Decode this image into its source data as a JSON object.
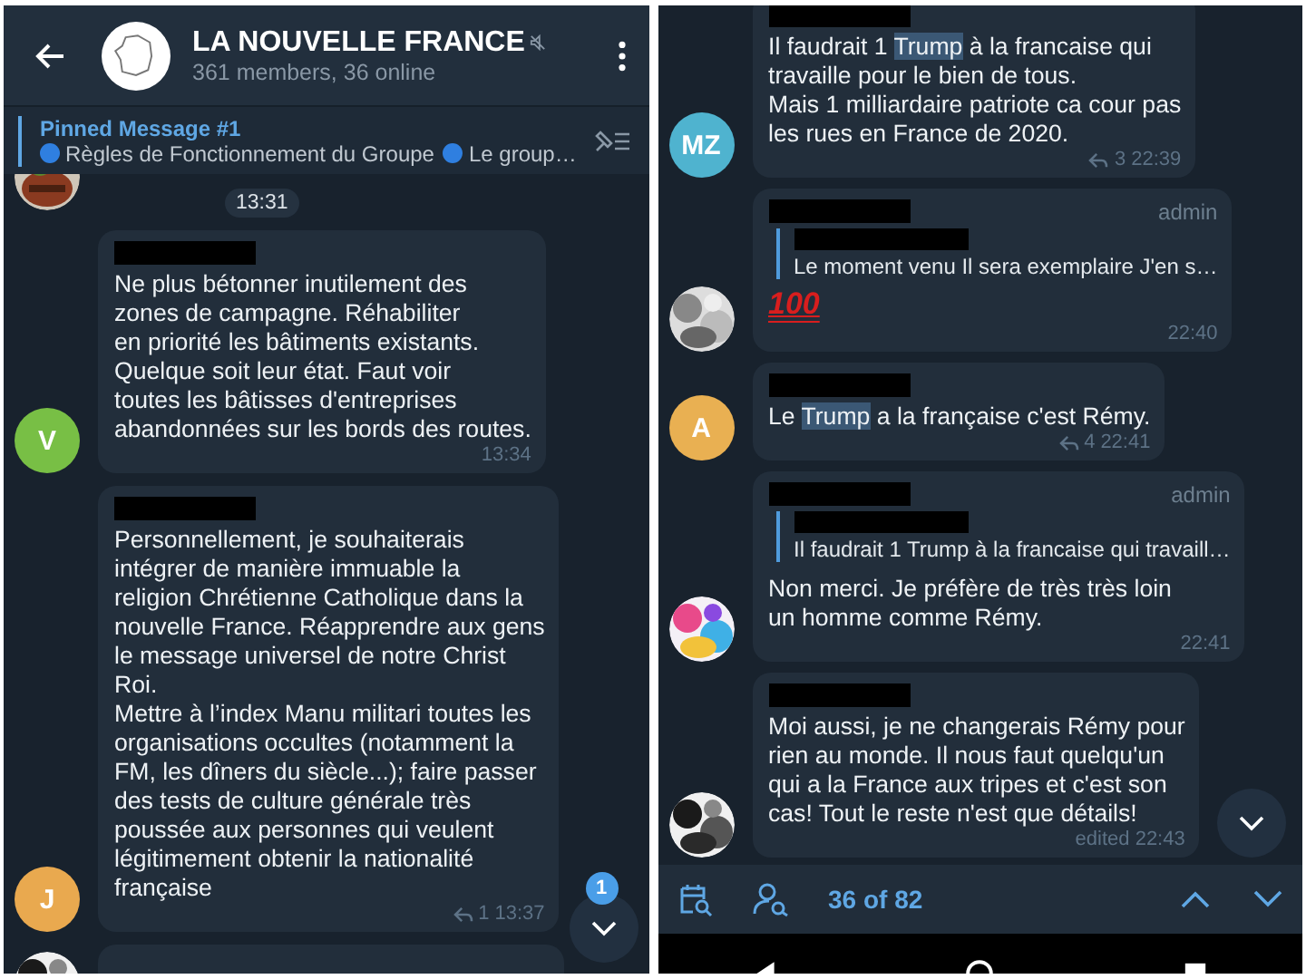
{
  "left_screen": {
    "header": {
      "title": "LA NOUVELLE FRANCE",
      "muted": true,
      "subtitle": "361 members, 36 online"
    },
    "pinned": {
      "label": "Pinned Message #1",
      "parts": [
        "Règles de Fonctionnement du Groupe",
        "Le group…"
      ]
    },
    "date_chip": "13:31",
    "messages": [
      {
        "kind": "message",
        "avatar": {
          "kind": "letter",
          "letter": "V",
          "color": "#78bf45"
        },
        "sender_redacted": true,
        "lines": [
          "Ne plus bétonner inutilement des",
          "zones de campagne. Réhabiliter",
          "en priorité les bâtiments existants.",
          "Quelque soit leur état.  Faut voir",
          "toutes les bâtisses d'entreprises",
          "abandonnées sur les bords des routes."
        ],
        "time": "13:34"
      },
      {
        "kind": "message",
        "avatar": {
          "kind": "letter",
          "letter": "J",
          "color": "#e9a94f"
        },
        "sender_redacted": true,
        "lines": [
          "Personnellement, je souhaiterais",
          "intégrer de manière immuable la",
          "religion Chrétienne Catholique dans la",
          "nouvelle France. Réapprendre aux gens",
          "le message universel de notre Christ",
          "Roi.",
          "Mettre à l’index Manu militari toutes les",
          "organisations occultes (notamment la",
          "FM, les dîners du siècle...); faire passer",
          "des tests de culture générale très",
          "poussée aux personnes qui veulent",
          "légitimement obtenir la nationalité",
          "française"
        ],
        "replies": "1",
        "time": "13:37"
      },
      {
        "kind": "cut",
        "avatar": {
          "kind": "picture"
        }
      }
    ],
    "scroll_down_button": {
      "badge": "1"
    }
  },
  "right_screen": {
    "messages": [
      {
        "kind": "message",
        "avatar": {
          "kind": "letter",
          "letter": "MZ",
          "color": "#4fb3cf"
        },
        "sender_redacted": true,
        "lines": [
          [
            {
              "text": "Il faudrait 1 ",
              "highlighted": false
            },
            {
              "text": "Trump",
              "highlighted": true
            },
            {
              "text": " à la francaise qui",
              "highlighted": false
            }
          ],
          "travaille pour le bien de tous.",
          "Mais 1 milliardaire patriote ca cour pas",
          "les rues en France de 2020."
        ],
        "replies": "3",
        "time": "22:39"
      },
      {
        "kind": "message",
        "avatar": {
          "kind": "picture"
        },
        "sender_redacted": true,
        "role": "admin",
        "reply_quote": {
          "text": "Le moment venu  Il sera exemplaire  J'en s…"
        },
        "emoji": "100",
        "time": "22:40"
      },
      {
        "kind": "message",
        "avatar": {
          "kind": "letter",
          "letter": "A",
          "color": "#e9b052"
        },
        "sender_redacted": true,
        "lines": [
          [
            {
              "text": "Le ",
              "highlighted": false
            },
            {
              "text": "Trump",
              "highlighted": true
            },
            {
              "text": " a la française c'est Rémy.",
              "highlighted": false
            }
          ]
        ],
        "replies": "4",
        "time": "22:41"
      },
      {
        "kind": "message",
        "avatar": {
          "kind": "picture"
        },
        "sender_redacted": true,
        "role": "admin",
        "reply_quote": {
          "text": "Il faudrait 1 Trump à la francaise qui travaill…"
        },
        "lines": [
          "Non merci. Je préfère de très très loin",
          "un homme comme Rémy."
        ],
        "time": "22:41"
      },
      {
        "kind": "message",
        "avatar": {
          "kind": "picture"
        },
        "sender_redacted": true,
        "lines": [
          "Moi aussi, je ne changerais Rémy pour",
          "rien au monde. Il nous faut quelqu'un",
          "qui a la France aux tripes  et c'est son",
          "cas! Tout le reste n'est que détails!"
        ],
        "time": "edited 22:43"
      }
    ],
    "search_bar": {
      "counter": "36 of 82"
    }
  }
}
